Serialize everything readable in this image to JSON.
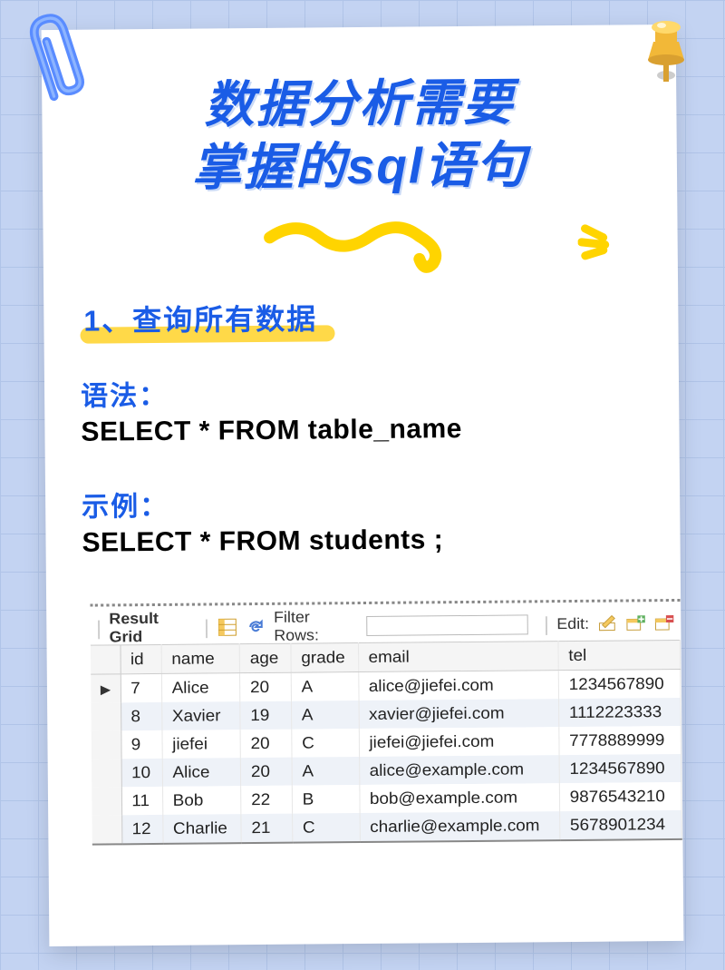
{
  "title_line1": "数据分析需要",
  "title_line2": "掌握的sql语句",
  "section_heading": "1、查询所有数据",
  "syntax_label": "语法：",
  "syntax_code": "SELECT * FROM table_name",
  "example_label": "示例：",
  "example_code": "SELECT * FROM students ;",
  "toolbar": {
    "result_grid": "Result Grid",
    "filter_label": "Filter Rows:",
    "filter_value": "",
    "edit_label": "Edit:"
  },
  "table": {
    "columns": [
      "id",
      "name",
      "age",
      "grade",
      "email",
      "tel"
    ],
    "rows": [
      {
        "id": "7",
        "name": "Alice",
        "age": "20",
        "grade": "A",
        "email": "alice@jiefei.com",
        "tel": "1234567890",
        "pointer": true
      },
      {
        "id": "8",
        "name": "Xavier",
        "age": "19",
        "grade": "A",
        "email": "xavier@jiefei.com",
        "tel": "1112223333"
      },
      {
        "id": "9",
        "name": "jiefei",
        "age": "20",
        "grade": "C",
        "email": "jiefei@jiefei.com",
        "tel": "7778889999"
      },
      {
        "id": "10",
        "name": "Alice",
        "age": "20",
        "grade": "A",
        "email": "alice@example.com",
        "tel": "1234567890"
      },
      {
        "id": "11",
        "name": "Bob",
        "age": "22",
        "grade": "B",
        "email": "bob@example.com",
        "tel": "9876543210"
      },
      {
        "id": "12",
        "name": "Charlie",
        "age": "21",
        "grade": "C",
        "email": "charlie@example.com",
        "tel": "5678901234"
      }
    ]
  }
}
